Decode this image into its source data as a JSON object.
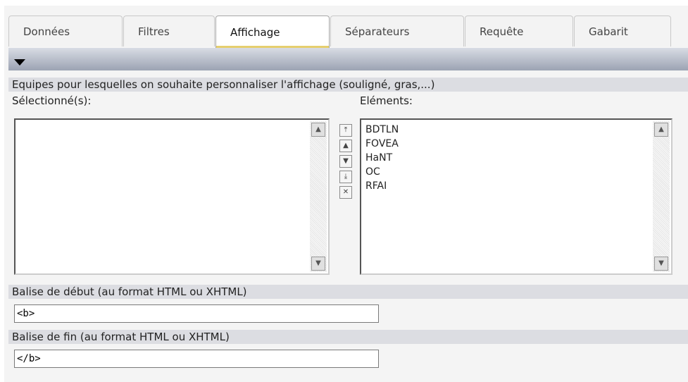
{
  "tabs": [
    {
      "label": "Données"
    },
    {
      "label": "Filtres"
    },
    {
      "label": "Affichage",
      "active": true
    },
    {
      "label": "Séparateurs"
    },
    {
      "label": "Requête"
    },
    {
      "label": "Gabarit"
    }
  ],
  "colors": {
    "active_tab_underline": "#e6cf6e",
    "collapse_bar": "#9ca3b3"
  },
  "teams_section": {
    "title": "Equipes pour lesquelles on souhaite personnaliser l'affichage (souligné, gras,...)",
    "selected_label": "Sélectionné(s):",
    "elements_label": "Eléments:",
    "selected_items": [],
    "elements_items": [
      "BDTLN",
      "FOVEA",
      "HaNT",
      "OC",
      "RFAI"
    ]
  },
  "controls": {
    "move_top": "⤒",
    "move_up": "▲",
    "move_down": "▼",
    "move_bottom": "⤓",
    "remove": "✕"
  },
  "start_tag": {
    "label": "Balise de début (au format HTML ou XHTML)",
    "value": "<b>"
  },
  "end_tag": {
    "label": "Balise de fin (au format HTML ou XHTML)",
    "value": "</b>"
  }
}
